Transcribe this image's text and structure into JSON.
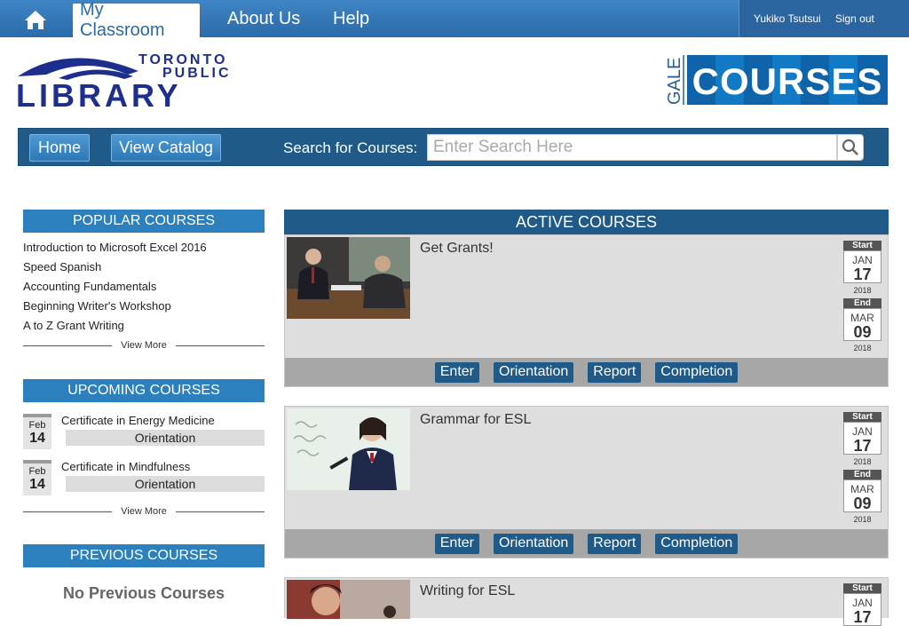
{
  "topnav": {
    "tabs": [
      {
        "label": "My Classroom"
      },
      {
        "label": "About Us"
      },
      {
        "label": "Help"
      }
    ],
    "user_name": "Yukiko Tsutsui",
    "sign_out": "Sign out"
  },
  "logos": {
    "library_line1": "TORONTO",
    "library_line2": "PUBLIC",
    "library_line3": "LIBRARY",
    "gale_small": "GALE",
    "gale_big": "COURSES"
  },
  "navbar": {
    "home_label": "Home",
    "catalog_label": "View Catalog",
    "search_label": "Search for Courses:",
    "search_placeholder": "Enter Search Here"
  },
  "sidebar": {
    "popular_header": "POPULAR COURSES",
    "popular_items": [
      "Introduction to Microsoft Excel 2016",
      "Speed Spanish",
      "Accounting Fundamentals",
      "Beginning Writer's Workshop",
      "A to Z Grant Writing"
    ],
    "view_more": "View More",
    "upcoming_header": "UPCOMING COURSES",
    "upcoming_items": [
      {
        "month": "Feb",
        "day": "14",
        "title": "Certificate in Energy Medicine",
        "action": "Orientation"
      },
      {
        "month": "Feb",
        "day": "14",
        "title": "Certificate in Mindfulness",
        "action": "Orientation"
      }
    ],
    "previous_header": "PREVIOUS COURSES",
    "no_previous": "No Previous Courses"
  },
  "main": {
    "header": "ACTIVE COURSES",
    "start_label": "Start",
    "end_label": "End",
    "actions": [
      "Enter",
      "Orientation",
      "Report",
      "Completion"
    ],
    "courses": [
      {
        "title": "Get Grants!",
        "start_month": "JAN",
        "start_day": "17",
        "start_year": "2018",
        "end_month": "MAR",
        "end_day": "09",
        "end_year": "2018"
      },
      {
        "title": "Grammar for ESL",
        "start_month": "JAN",
        "start_day": "17",
        "start_year": "2018",
        "end_month": "MAR",
        "end_day": "09",
        "end_year": "2018"
      },
      {
        "title": "Writing for ESL",
        "start_month": "JAN",
        "start_day": "17"
      }
    ]
  },
  "colors": {
    "topbar": "#3f85c5",
    "navbar": "#1f5a88",
    "section_header": "#2b80bd",
    "card_bg": "#dedede",
    "action_bar": "#a7a7a7"
  }
}
